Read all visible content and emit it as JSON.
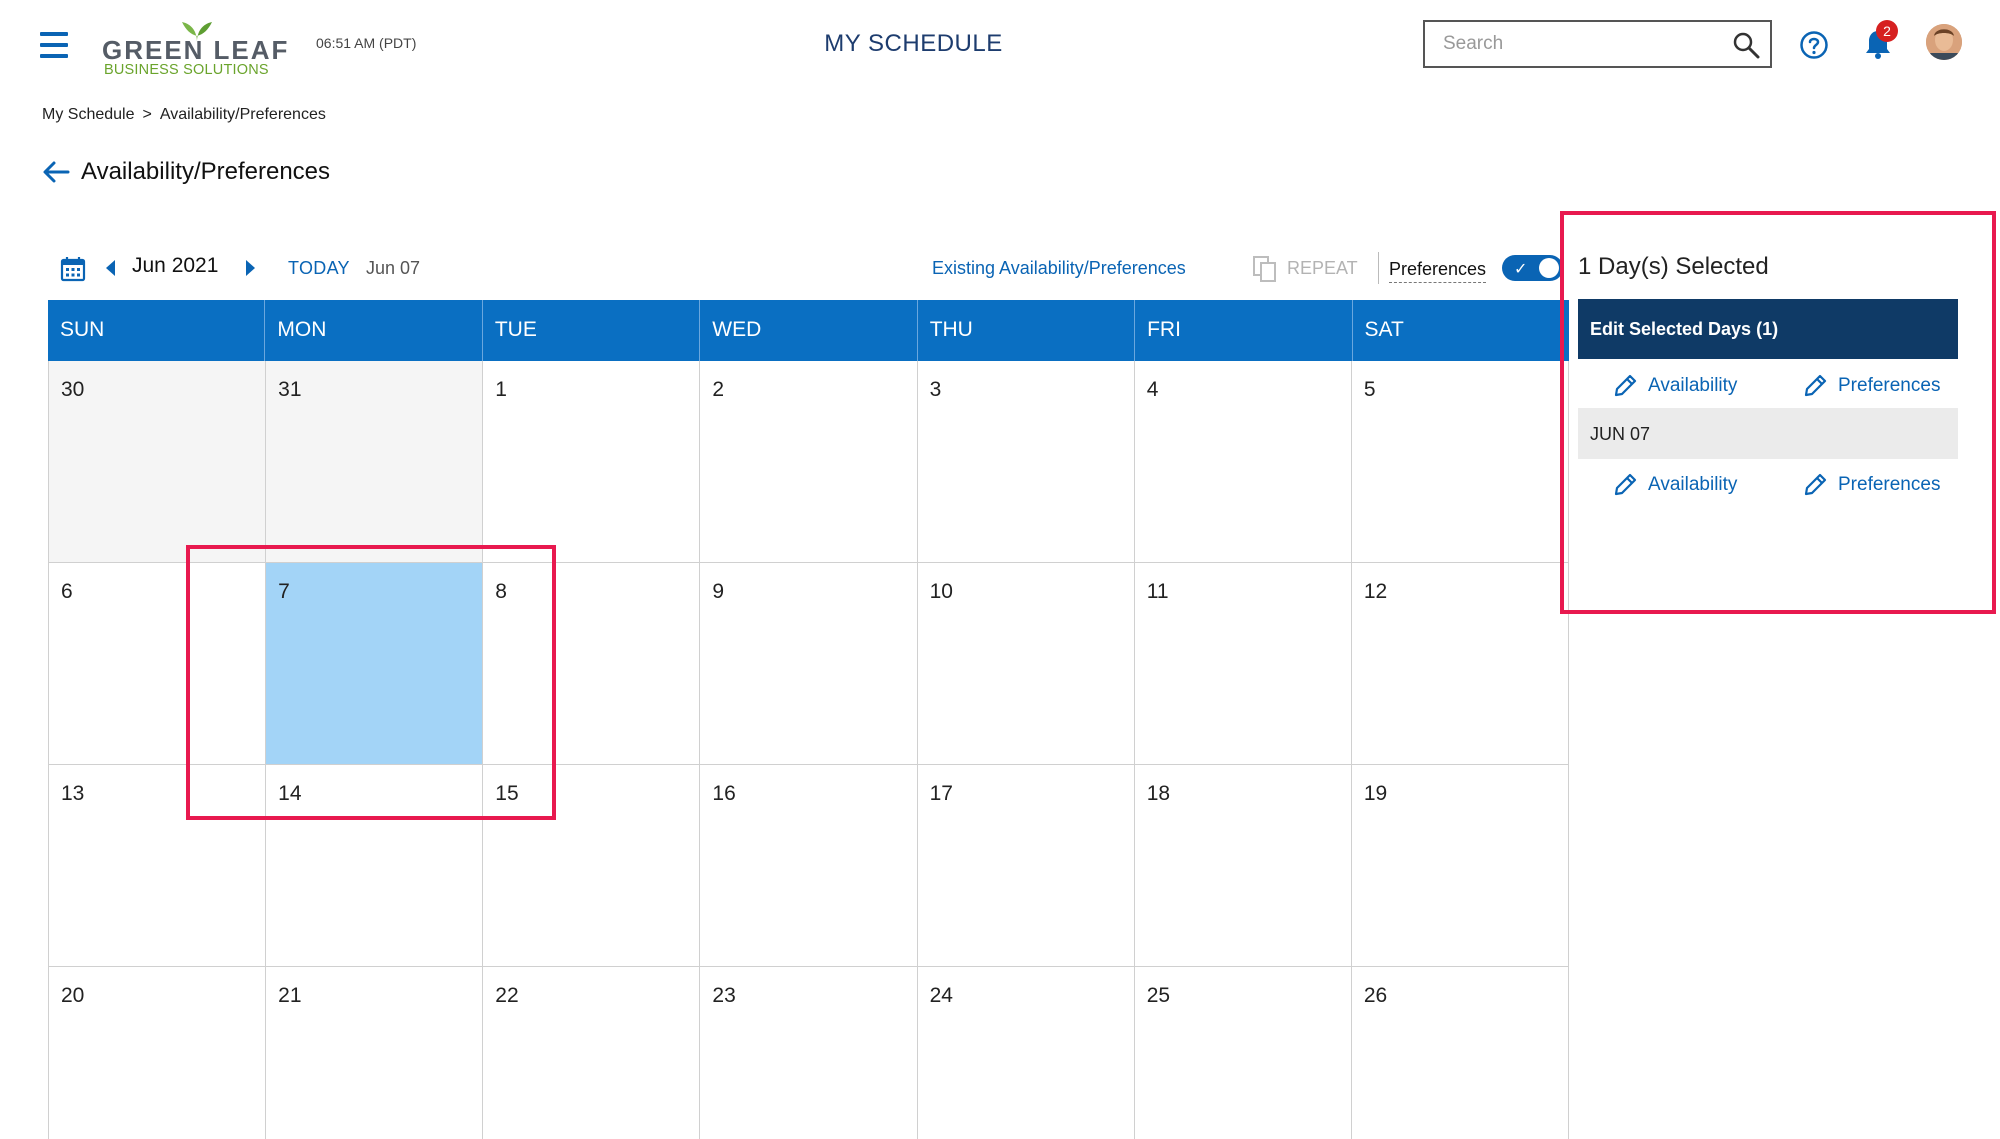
{
  "header": {
    "menu_icon": "hamburger-icon",
    "logo": {
      "line1_part1": "GREEN",
      "line1_part2": "LEAF",
      "line2": "BUSINESS SOLUTIONS"
    },
    "clock": "06:51 AM (PDT)",
    "app_title": "MY SCHEDULE",
    "search": {
      "placeholder": "Search",
      "icon": "search-icon"
    },
    "help_icon": "help-icon",
    "notifications": {
      "icon": "bell-icon",
      "count": "2"
    },
    "avatar": "user-avatar"
  },
  "breadcrumb": {
    "items": [
      "My Schedule",
      "Availability/Preferences"
    ],
    "separator": ">"
  },
  "page": {
    "title": "Availability/Preferences",
    "back_icon": "arrow-left-icon"
  },
  "toolbar": {
    "month": "Jun 2021",
    "today_label": "TODAY",
    "today_date": "Jun 07",
    "existing_link": "Existing Availability/Preferences",
    "repeat_label": "REPEAT",
    "preferences_label": "Preferences",
    "preferences_toggle_on": true
  },
  "calendar": {
    "day_headers": [
      "SUN",
      "MON",
      "TUE",
      "WED",
      "THU",
      "FRI",
      "SAT"
    ],
    "weeks": [
      [
        "30",
        "31",
        "1",
        "2",
        "3",
        "4",
        "5"
      ],
      [
        "6",
        "7",
        "8",
        "9",
        "10",
        "11",
        "12"
      ],
      [
        "13",
        "14",
        "15",
        "16",
        "17",
        "18",
        "19"
      ],
      [
        "20",
        "21",
        "22",
        "23",
        "24",
        "25",
        "26"
      ]
    ],
    "outside_month_days": [
      "30",
      "31"
    ],
    "selected_day": "7",
    "header_color": "#0a6fc2",
    "selected_color": "#a3d4f7"
  },
  "side_panel": {
    "title": "1 Day(s) Selected",
    "edit_bar_label": "Edit Selected Days (1)",
    "group_actions": {
      "availability": "Availability",
      "preferences": "Preferences"
    },
    "date_label": "JUN 07",
    "date_actions": {
      "availability": "Availability",
      "preferences": "Preferences"
    }
  },
  "colors": {
    "accent": "#0a64b4",
    "edit_bar": "#0f3a66",
    "highlight": "#e8194f"
  }
}
